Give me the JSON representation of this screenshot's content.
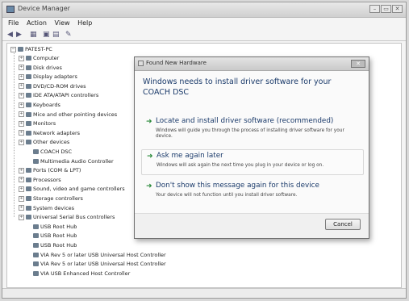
{
  "window": {
    "title": "Device Manager",
    "controls": [
      "–",
      "▭",
      "✕"
    ]
  },
  "menu": [
    "File",
    "Action",
    "View",
    "Help"
  ],
  "toolbar": [
    "◀",
    "▶",
    "▦",
    "▣",
    "▤",
    "✎"
  ],
  "tree": {
    "root": "PATEST-PC",
    "items": [
      {
        "label": "Computer",
        "depth": 1
      },
      {
        "label": "Disk drives",
        "depth": 1
      },
      {
        "label": "Display adapters",
        "depth": 1
      },
      {
        "label": "DVD/CD-ROM drives",
        "depth": 1
      },
      {
        "label": "IDE ATA/ATAPI controllers",
        "depth": 1
      },
      {
        "label": "Keyboards",
        "depth": 1
      },
      {
        "label": "Mice and other pointing devices",
        "depth": 1
      },
      {
        "label": "Monitors",
        "depth": 1
      },
      {
        "label": "Network adapters",
        "depth": 1
      },
      {
        "label": "Other devices",
        "depth": 1
      },
      {
        "label": "COACH DSC",
        "depth": 2
      },
      {
        "label": "Multimedia Audio Controller",
        "depth": 2
      },
      {
        "label": "Ports (COM & LPT)",
        "depth": 1
      },
      {
        "label": "Processors",
        "depth": 1
      },
      {
        "label": "Sound, video and game controllers",
        "depth": 1
      },
      {
        "label": "Storage controllers",
        "depth": 1
      },
      {
        "label": "System devices",
        "depth": 1
      },
      {
        "label": "Universal Serial Bus controllers",
        "depth": 1
      },
      {
        "label": "USB Root Hub",
        "depth": 2
      },
      {
        "label": "USB Root Hub",
        "depth": 2
      },
      {
        "label": "USB Root Hub",
        "depth": 2
      },
      {
        "label": "VIA Rev 5 or later USB Universal Host Controller",
        "depth": 2
      },
      {
        "label": "VIA Rev 5 or later USB Universal Host Controller",
        "depth": 2
      },
      {
        "label": "VIA USB Enhanced Host Controller",
        "depth": 2
      }
    ]
  },
  "dialog": {
    "title": "Found New Hardware",
    "heading": "Windows needs to install driver software for your COACH DSC",
    "options": [
      {
        "title": "Locate and install driver software (recommended)",
        "desc": "Windows will guide you through the process of installing driver software for your device."
      },
      {
        "title": "Ask me again later",
        "desc": "Windows will ask again the next time you plug in your device or log on."
      },
      {
        "title": "Don't show this message again for this device",
        "desc": "Your device will not function until you install driver software."
      }
    ],
    "cancel_label": "Cancel",
    "close_glyph": "✕",
    "option_icon": "➜"
  },
  "colors": {
    "heading": "#1a3a6a",
    "option_arrow": "#2a8a3a"
  }
}
